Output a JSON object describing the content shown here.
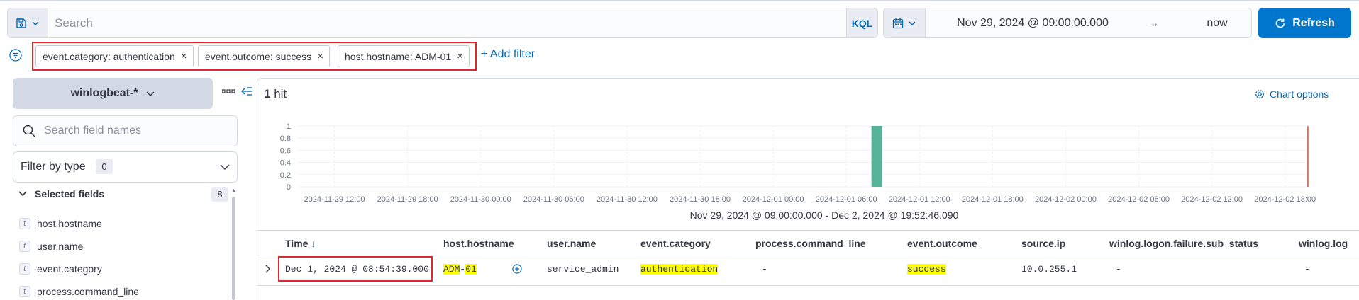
{
  "search": {
    "placeholder": "Search",
    "language": "KQL"
  },
  "date": {
    "start": "Nov 29, 2024 @ 09:00:00.000",
    "arrow": "→",
    "end": "now"
  },
  "refresh": {
    "label": "Refresh"
  },
  "filters": [
    {
      "label": "event.category: authentication"
    },
    {
      "label": "event.outcome: success"
    },
    {
      "label": "host.hostname: ADM-01"
    }
  ],
  "add_filter": "+ Add filter",
  "sidebar": {
    "data_view": "winlogbeat-*",
    "field_search_placeholder": "Search field names",
    "filter_by_type": {
      "label": "Filter by type",
      "count": "0"
    },
    "selected_fields": {
      "label": "Selected fields",
      "count": "8"
    },
    "fields": [
      {
        "type": "t",
        "name": "host.hostname"
      },
      {
        "type": "t",
        "name": "user.name"
      },
      {
        "type": "t",
        "name": "event.category"
      },
      {
        "type": "t",
        "name": "process.command_line"
      }
    ]
  },
  "results": {
    "count": "1",
    "unit": "hit",
    "chart_options": "Chart options"
  },
  "chart_data": {
    "type": "bar",
    "x_ticks": [
      "2024-11-29 12:00",
      "2024-11-29 18:00",
      "2024-11-30 00:00",
      "2024-11-30 06:00",
      "2024-11-30 12:00",
      "2024-11-30 18:00",
      "2024-12-01 00:00",
      "2024-12-01 06:00",
      "2024-12-01 12:00",
      "2024-12-01 18:00",
      "2024-12-02 00:00",
      "2024-12-02 06:00",
      "2024-12-02 12:00",
      "2024-12-02 18:00"
    ],
    "y_ticks": [
      "1",
      "0.8",
      "0.6",
      "0.4",
      "0.2",
      "0"
    ],
    "ylim": [
      0,
      1
    ],
    "bars": [
      {
        "x": "2024-12-01 08:30",
        "value": 1
      }
    ],
    "now_marker": "2024-12-02 19:52",
    "range_label": "Nov 29, 2024 @ 09:00:00.000 - Dec 2, 2024 @ 19:52:46.090",
    "colors": {
      "bar": "#54b399",
      "now": "#e7664c"
    }
  },
  "table": {
    "columns": [
      "Time",
      "host.hostname",
      "user.name",
      "event.category",
      "process.command_line",
      "event.outcome",
      "source.ip",
      "winlog.logon.failure.sub_status",
      "winlog.log"
    ],
    "row": {
      "time": "Dec 1, 2024 @ 08:54:39.000",
      "host_a": "ADM",
      "host_sep": "-",
      "host_b": "01",
      "user": "service_admin",
      "category": "authentication",
      "command_line": "-",
      "outcome": "success",
      "source_ip": "10.0.255.1",
      "sub_status": "-",
      "last": "-"
    }
  },
  "colors": {
    "accent": "#0077cc",
    "highlight_box": "#e0262f",
    "match_highlight": "#ffff00"
  }
}
